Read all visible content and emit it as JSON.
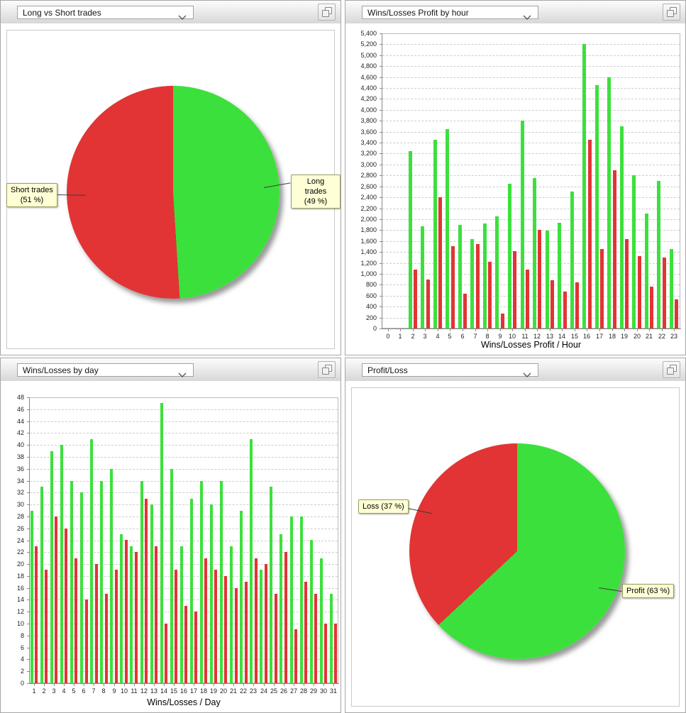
{
  "icons": {
    "dropdown_chevron": "chevron-down-icon",
    "panel_button": "duplicate-window-icon"
  },
  "colors": {
    "win_green": "#3ce03c",
    "loss_red": "#e23434",
    "callout_bg": "#ffffd6",
    "callout_border": "#9c9c62"
  },
  "panels": [
    {
      "dropdown_value": "Long vs Short trades"
    },
    {
      "dropdown_value": "Wins/Losses Profit by hour"
    },
    {
      "dropdown_value": "Wins/Losses by day"
    },
    {
      "dropdown_value": "Profit/Loss"
    }
  ],
  "chart_data": [
    {
      "type": "pie",
      "title": "Long vs Short trades",
      "start_angle_deg": 0,
      "direction": "clockwise",
      "slices": [
        {
          "label": "Long trades",
          "pct": 49,
          "color": "#3ce03c",
          "callout": "Long trades\n(49 %)"
        },
        {
          "label": "Short trades",
          "pct": 51,
          "color": "#e23434",
          "callout": "Short trades\n(51 %)"
        }
      ]
    },
    {
      "type": "bar",
      "title": "Wins/Losses Profit by hour",
      "xlabel": "Wins/Losses Profit / Hour",
      "ylim": [
        0,
        5400
      ],
      "ytick_step": 200,
      "grid": "dashed-horizontal",
      "legend": "none",
      "categories": [
        "0",
        "1",
        "2",
        "3",
        "4",
        "5",
        "6",
        "7",
        "8",
        "9",
        "10",
        "11",
        "12",
        "13",
        "14",
        "15",
        "16",
        "17",
        "18",
        "19",
        "20",
        "21",
        "22",
        "23"
      ],
      "series": [
        {
          "name": "Wins",
          "color": "#3ce03c",
          "values": [
            0,
            0,
            3250,
            1870,
            3450,
            3650,
            1900,
            1630,
            1920,
            2050,
            2650,
            3800,
            2750,
            1790,
            1930,
            2500,
            5200,
            4450,
            4600,
            3700,
            2800,
            2100,
            2700,
            1450
          ]
        },
        {
          "name": "Losses",
          "color": "#e23434",
          "values": [
            0,
            0,
            1080,
            900,
            2400,
            1500,
            630,
            1550,
            1220,
            270,
            1420,
            1080,
            1800,
            880,
            680,
            840,
            3450,
            1450,
            2900,
            1630,
            1320,
            770,
            1300,
            530
          ]
        }
      ]
    },
    {
      "type": "bar",
      "title": "Wins/Losses by day",
      "xlabel": "Wins/Losses / Day",
      "ylim": [
        0,
        48
      ],
      "ytick_step": 2,
      "grid": "dashed-horizontal",
      "legend": "none",
      "categories": [
        "1",
        "2",
        "3",
        "4",
        "5",
        "6",
        "7",
        "8",
        "9",
        "10",
        "11",
        "12",
        "13",
        "14",
        "15",
        "16",
        "17",
        "18",
        "19",
        "20",
        "21",
        "22",
        "23",
        "24",
        "25",
        "26",
        "27",
        "28",
        "29",
        "30",
        "31"
      ],
      "series": [
        {
          "name": "Wins",
          "color": "#3ce03c",
          "values": [
            29,
            33,
            39,
            40,
            34,
            32,
            41,
            34,
            36,
            25,
            23,
            34,
            30,
            47,
            36,
            23,
            31,
            34,
            30,
            34,
            23,
            29,
            41,
            19,
            33,
            25,
            28,
            28,
            24,
            21,
            15
          ]
        },
        {
          "name": "Losses",
          "color": "#e23434",
          "values": [
            23,
            19,
            28,
            26,
            21,
            14,
            20,
            15,
            19,
            24,
            22,
            31,
            23,
            10,
            19,
            13,
            12,
            21,
            19,
            18,
            16,
            17,
            21,
            20,
            15,
            22,
            9,
            17,
            15,
            10,
            10
          ]
        }
      ]
    },
    {
      "type": "pie",
      "title": "Profit/Loss",
      "start_angle_deg": 0,
      "direction": "clockwise",
      "slices": [
        {
          "label": "Profit",
          "pct": 63,
          "color": "#3ce03c",
          "callout": "Profit (63 %)"
        },
        {
          "label": "Loss",
          "pct": 37,
          "color": "#e23434",
          "callout": "Loss (37 %)"
        }
      ]
    }
  ]
}
